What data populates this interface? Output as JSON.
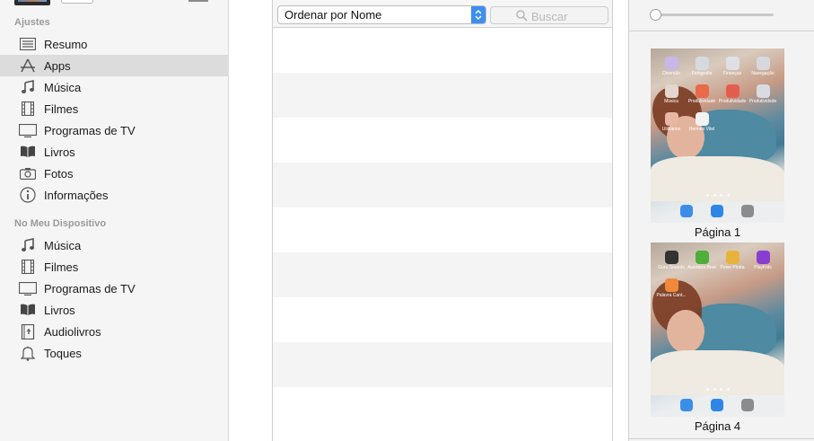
{
  "sidebar": {
    "settings_header": "Ajustes",
    "settings_items": [
      {
        "label": "Resumo",
        "icon": "summary-list-icon",
        "selected": false
      },
      {
        "label": "Apps",
        "icon": "apps-icon",
        "selected": true
      },
      {
        "label": "Música",
        "icon": "music-note-icon",
        "selected": false
      },
      {
        "label": "Filmes",
        "icon": "film-icon",
        "selected": false
      },
      {
        "label": "Programas de TV",
        "icon": "tv-icon",
        "selected": false
      },
      {
        "label": "Livros",
        "icon": "book-icon",
        "selected": false
      },
      {
        "label": "Fotos",
        "icon": "camera-icon",
        "selected": false
      },
      {
        "label": "Informações",
        "icon": "info-icon",
        "selected": false
      }
    ],
    "device_header": "No Meu Dispositivo",
    "device_items": [
      {
        "label": "Música",
        "icon": "music-note-icon"
      },
      {
        "label": "Filmes",
        "icon": "film-icon"
      },
      {
        "label": "Programas de TV",
        "icon": "tv-icon"
      },
      {
        "label": "Livros",
        "icon": "book-icon"
      },
      {
        "label": "Audiolivros",
        "icon": "audiobook-icon"
      },
      {
        "label": "Toques",
        "icon": "bell-icon"
      }
    ]
  },
  "app_list": {
    "sort_label": "Ordenar por Nome",
    "search_placeholder": "Buscar"
  },
  "home_screens": {
    "zoom_level": 0,
    "pages": [
      {
        "label": "Página 1",
        "apps": [
          "Diversão",
          "Fotografia",
          "Finanças",
          "Navegação",
          "Música",
          "Produtividade",
          "Produtividade",
          "Produtividade",
          "Utilitários",
          "Hermes Vitel"
        ]
      },
      {
        "label": "Página 4",
        "apps": [
          "Guru Sounds",
          "Aventura Bnut",
          "Peixe Pirata",
          "PlayKids",
          "Palavra Cant..."
        ]
      }
    ]
  },
  "colors": {
    "accent": "#3e8ef0",
    "sidebar_bg": "#f5f5f5",
    "selected_row": "#dcdcdc",
    "stripe": "#f4f4f4"
  }
}
